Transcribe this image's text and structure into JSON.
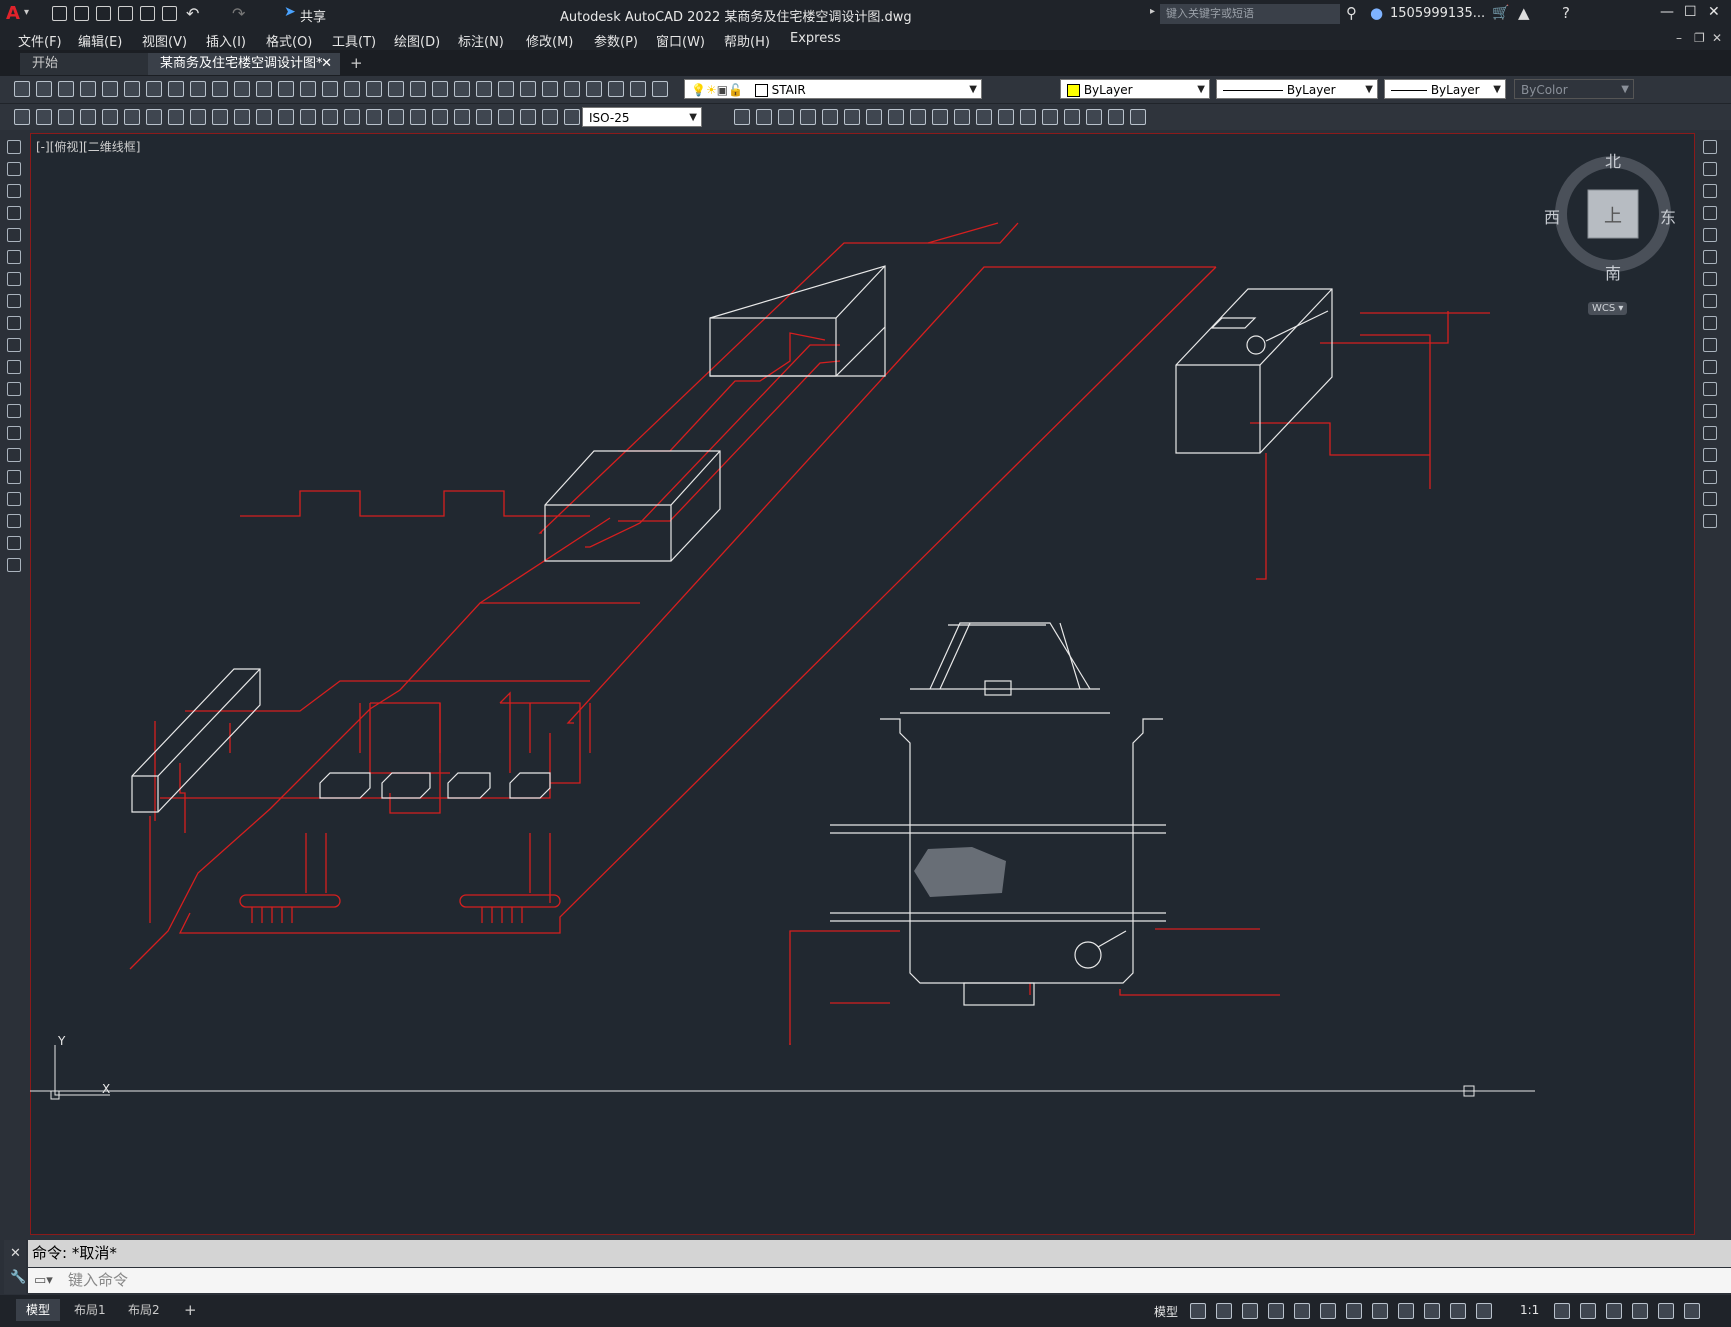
{
  "window": {
    "title": "Autodesk AutoCAD 2022    某商务及住宅楼空调设计图.dwg",
    "search_placeholder": "键入关键字或短语",
    "user": "1505999135...",
    "share_label": "共享",
    "logo": "A"
  },
  "menu": [
    "文件(F)",
    "编辑(E)",
    "视图(V)",
    "插入(I)",
    "格式(O)",
    "工具(T)",
    "绘图(D)",
    "标注(N)",
    "修改(M)",
    "参数(P)",
    "窗口(W)",
    "帮助(H)",
    "Express"
  ],
  "tabs": {
    "start": "开始",
    "document": "某商务及住宅楼空调设计图*",
    "close": "✕",
    "add": "+"
  },
  "toolbar": {
    "layer_name": "STAIR",
    "color": "ByLayer",
    "linetype": "ByLayer",
    "lineweight": "ByLayer",
    "plotstyle": "ByColor",
    "dimstyle": "ISO-25"
  },
  "viewport": {
    "label": "[-][俯视][二维线框]",
    "compass": {
      "north": "北",
      "south": "南",
      "east": "东",
      "west": "西",
      "top": "上"
    },
    "wcs": "WCS ▾"
  },
  "command": {
    "history": "命令: *取消*",
    "input_placeholder": "键入命令"
  },
  "status": {
    "model_tab": "模型",
    "layout1": "布局1",
    "layout2": "布局2",
    "add": "+",
    "model_label": "模型",
    "scale": "1:1"
  },
  "colors": {
    "accent_red": "#e0232b",
    "drawing_red": "#d61f1f",
    "drawing_white": "#e8e8e8",
    "canvas_bg": "#212830"
  }
}
